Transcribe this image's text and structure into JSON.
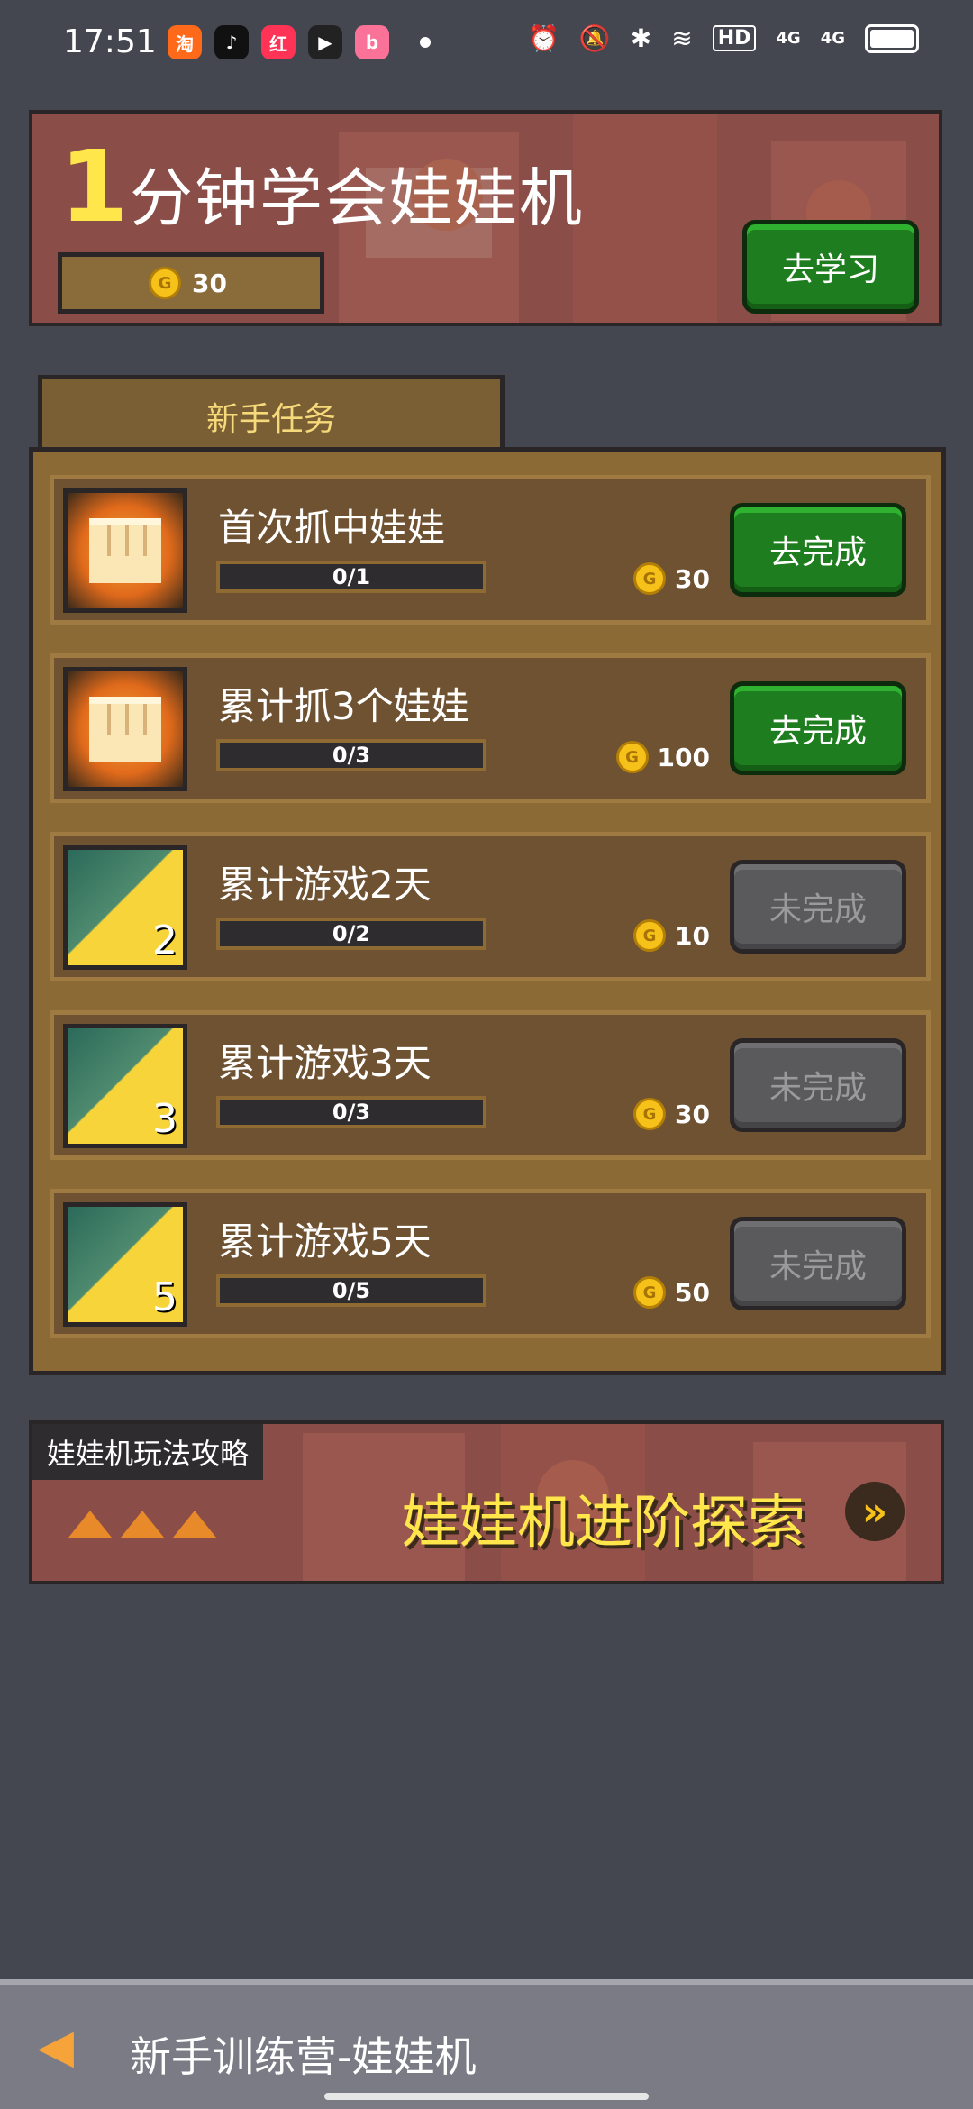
{
  "status_bar": {
    "time": "17:51",
    "apps": [
      "taobao-icon",
      "douyin-icon",
      "xiaohongshu-icon",
      "app-icon",
      "bilibili-icon"
    ],
    "signal_labels": [
      "4G",
      "4G"
    ],
    "hd_label": "HD"
  },
  "top_banner": {
    "big_number": "1",
    "title": "分钟学会娃娃机",
    "coins": "30",
    "button_label": "去学习"
  },
  "task_panel": {
    "tab_label": "新手任务",
    "tasks": [
      {
        "name": "首次抓中娃娃",
        "progress": "0/1",
        "reward": "30",
        "button": "去完成",
        "status": "active",
        "icon": "fist-icon"
      },
      {
        "name": "累计抓3个娃娃",
        "progress": "0/3",
        "reward": "100",
        "button": "去完成",
        "status": "active",
        "icon": "fist-icon"
      },
      {
        "name": "累计游戏2天",
        "progress": "0/2",
        "reward": "10",
        "button": "未完成",
        "status": "disabled",
        "icon": "lightning-icon",
        "day": "2"
      },
      {
        "name": "累计游戏3天",
        "progress": "0/3",
        "reward": "30",
        "button": "未完成",
        "status": "disabled",
        "icon": "lightning-icon",
        "day": "3"
      },
      {
        "name": "累计游戏5天",
        "progress": "0/5",
        "reward": "50",
        "button": "未完成",
        "status": "disabled",
        "icon": "lightning-icon",
        "day": "5"
      }
    ]
  },
  "guide_banner": {
    "label": "娃娃机玩法攻略",
    "title": "娃娃机进阶探索"
  },
  "bottom_bar": {
    "title": "新手训练营-娃娃机"
  },
  "colors": {
    "background": "#44474f",
    "banner": "#8a4d47",
    "panel": "#8c6a35",
    "green_button": "#1e7d1e",
    "gold": "#ffe64a"
  }
}
